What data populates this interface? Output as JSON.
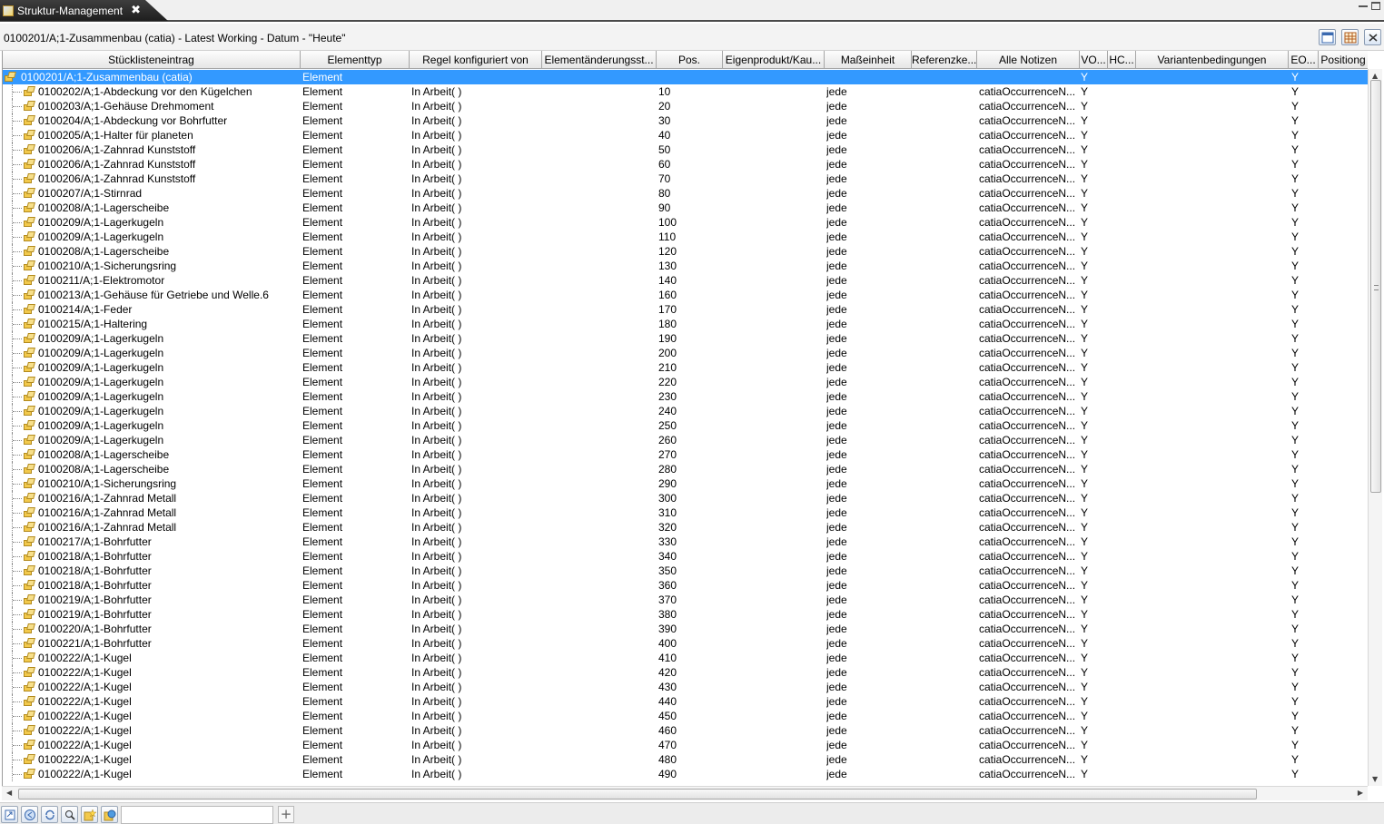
{
  "tab": {
    "title": "Struktur-Management",
    "close": "✖"
  },
  "info": {
    "path": "0100201/A;1-Zusammenbau (catia) - Latest Working - Datum - \"Heute\""
  },
  "columns": [
    {
      "label": "Stücklisteneintrag"
    },
    {
      "label": "Elementtyp"
    },
    {
      "label": "Regel konfiguriert von"
    },
    {
      "label": "Elementänderungsst..."
    },
    {
      "label": "Pos."
    },
    {
      "label": "Eigenprodukt/Kau..."
    },
    {
      "label": "Maßeinheit"
    },
    {
      "label": "Referenzke..."
    },
    {
      "label": "Alle Notizen"
    },
    {
      "label": "VO..."
    },
    {
      "label": "HC..."
    },
    {
      "label": "Variantenbedingungen"
    },
    {
      "label": "EO..."
    },
    {
      "label": "Positiong"
    }
  ],
  "root": {
    "entry": "0100201/A;1-Zusammenbau (catia)",
    "type": "Element",
    "vo": "Y",
    "eo": "Y"
  },
  "rows": [
    {
      "entry": "0100202/A;1-Abdeckung vor den Kügelchen",
      "type": "Element",
      "rule": "In Arbeit( )",
      "pos": "10",
      "unit": "jede",
      "notes": "catiaOccurrenceN...",
      "vo": "Y",
      "eo": "Y"
    },
    {
      "entry": "0100203/A;1-Gehäuse Drehmoment",
      "type": "Element",
      "rule": "In Arbeit( )",
      "pos": "20",
      "unit": "jede",
      "notes": "catiaOccurrenceN...",
      "vo": "Y",
      "eo": "Y"
    },
    {
      "entry": "0100204/A;1-Abdeckung vor Bohrfutter",
      "type": "Element",
      "rule": "In Arbeit( )",
      "pos": "30",
      "unit": "jede",
      "notes": "catiaOccurrenceN...",
      "vo": "Y",
      "eo": "Y"
    },
    {
      "entry": "0100205/A;1-Halter für planeten",
      "type": "Element",
      "rule": "In Arbeit( )",
      "pos": "40",
      "unit": "jede",
      "notes": "catiaOccurrenceN...",
      "vo": "Y",
      "eo": "Y"
    },
    {
      "entry": "0100206/A;1-Zahnrad Kunststoff",
      "type": "Element",
      "rule": "In Arbeit( )",
      "pos": "50",
      "unit": "jede",
      "notes": "catiaOccurrenceN...",
      "vo": "Y",
      "eo": "Y"
    },
    {
      "entry": "0100206/A;1-Zahnrad Kunststoff",
      "type": "Element",
      "rule": "In Arbeit( )",
      "pos": "60",
      "unit": "jede",
      "notes": "catiaOccurrenceN...",
      "vo": "Y",
      "eo": "Y"
    },
    {
      "entry": "0100206/A;1-Zahnrad Kunststoff",
      "type": "Element",
      "rule": "In Arbeit( )",
      "pos": "70",
      "unit": "jede",
      "notes": "catiaOccurrenceN...",
      "vo": "Y",
      "eo": "Y"
    },
    {
      "entry": "0100207/A;1-Stirnrad",
      "type": "Element",
      "rule": "In Arbeit( )",
      "pos": "80",
      "unit": "jede",
      "notes": "catiaOccurrenceN...",
      "vo": "Y",
      "eo": "Y"
    },
    {
      "entry": "0100208/A;1-Lagerscheibe",
      "type": "Element",
      "rule": "In Arbeit( )",
      "pos": "90",
      "unit": "jede",
      "notes": "catiaOccurrenceN...",
      "vo": "Y",
      "eo": "Y"
    },
    {
      "entry": "0100209/A;1-Lagerkugeln",
      "type": "Element",
      "rule": "In Arbeit( )",
      "pos": "100",
      "unit": "jede",
      "notes": "catiaOccurrenceN...",
      "vo": "Y",
      "eo": "Y"
    },
    {
      "entry": "0100209/A;1-Lagerkugeln",
      "type": "Element",
      "rule": "In Arbeit( )",
      "pos": "110",
      "unit": "jede",
      "notes": "catiaOccurrenceN...",
      "vo": "Y",
      "eo": "Y"
    },
    {
      "entry": "0100208/A;1-Lagerscheibe",
      "type": "Element",
      "rule": "In Arbeit( )",
      "pos": "120",
      "unit": "jede",
      "notes": "catiaOccurrenceN...",
      "vo": "Y",
      "eo": "Y"
    },
    {
      "entry": "0100210/A;1-Sicherungsring",
      "type": "Element",
      "rule": "In Arbeit( )",
      "pos": "130",
      "unit": "jede",
      "notes": "catiaOccurrenceN...",
      "vo": "Y",
      "eo": "Y"
    },
    {
      "entry": "0100211/A;1-Elektromotor",
      "type": "Element",
      "rule": "In Arbeit( )",
      "pos": "140",
      "unit": "jede",
      "notes": "catiaOccurrenceN...",
      "vo": "Y",
      "eo": "Y"
    },
    {
      "entry": "0100213/A;1-Gehäuse für Getriebe und Welle.6",
      "type": "Element",
      "rule": "In Arbeit( )",
      "pos": "160",
      "unit": "jede",
      "notes": "catiaOccurrenceN...",
      "vo": "Y",
      "eo": "Y"
    },
    {
      "entry": "0100214/A;1-Feder",
      "type": "Element",
      "rule": "In Arbeit( )",
      "pos": "170",
      "unit": "jede",
      "notes": "catiaOccurrenceN...",
      "vo": "Y",
      "eo": "Y"
    },
    {
      "entry": "0100215/A;1-Haltering",
      "type": "Element",
      "rule": "In Arbeit( )",
      "pos": "180",
      "unit": "jede",
      "notes": "catiaOccurrenceN...",
      "vo": "Y",
      "eo": "Y"
    },
    {
      "entry": "0100209/A;1-Lagerkugeln",
      "type": "Element",
      "rule": "In Arbeit( )",
      "pos": "190",
      "unit": "jede",
      "notes": "catiaOccurrenceN...",
      "vo": "Y",
      "eo": "Y"
    },
    {
      "entry": "0100209/A;1-Lagerkugeln",
      "type": "Element",
      "rule": "In Arbeit( )",
      "pos": "200",
      "unit": "jede",
      "notes": "catiaOccurrenceN...",
      "vo": "Y",
      "eo": "Y"
    },
    {
      "entry": "0100209/A;1-Lagerkugeln",
      "type": "Element",
      "rule": "In Arbeit( )",
      "pos": "210",
      "unit": "jede",
      "notes": "catiaOccurrenceN...",
      "vo": "Y",
      "eo": "Y"
    },
    {
      "entry": "0100209/A;1-Lagerkugeln",
      "type": "Element",
      "rule": "In Arbeit( )",
      "pos": "220",
      "unit": "jede",
      "notes": "catiaOccurrenceN...",
      "vo": "Y",
      "eo": "Y"
    },
    {
      "entry": "0100209/A;1-Lagerkugeln",
      "type": "Element",
      "rule": "In Arbeit( )",
      "pos": "230",
      "unit": "jede",
      "notes": "catiaOccurrenceN...",
      "vo": "Y",
      "eo": "Y"
    },
    {
      "entry": "0100209/A;1-Lagerkugeln",
      "type": "Element",
      "rule": "In Arbeit( )",
      "pos": "240",
      "unit": "jede",
      "notes": "catiaOccurrenceN...",
      "vo": "Y",
      "eo": "Y"
    },
    {
      "entry": "0100209/A;1-Lagerkugeln",
      "type": "Element",
      "rule": "In Arbeit( )",
      "pos": "250",
      "unit": "jede",
      "notes": "catiaOccurrenceN...",
      "vo": "Y",
      "eo": "Y"
    },
    {
      "entry": "0100209/A;1-Lagerkugeln",
      "type": "Element",
      "rule": "In Arbeit( )",
      "pos": "260",
      "unit": "jede",
      "notes": "catiaOccurrenceN...",
      "vo": "Y",
      "eo": "Y"
    },
    {
      "entry": "0100208/A;1-Lagerscheibe",
      "type": "Element",
      "rule": "In Arbeit( )",
      "pos": "270",
      "unit": "jede",
      "notes": "catiaOccurrenceN...",
      "vo": "Y",
      "eo": "Y"
    },
    {
      "entry": "0100208/A;1-Lagerscheibe",
      "type": "Element",
      "rule": "In Arbeit( )",
      "pos": "280",
      "unit": "jede",
      "notes": "catiaOccurrenceN...",
      "vo": "Y",
      "eo": "Y"
    },
    {
      "entry": "0100210/A;1-Sicherungsring",
      "type": "Element",
      "rule": "In Arbeit( )",
      "pos": "290",
      "unit": "jede",
      "notes": "catiaOccurrenceN...",
      "vo": "Y",
      "eo": "Y"
    },
    {
      "entry": "0100216/A;1-Zahnrad Metall",
      "type": "Element",
      "rule": "In Arbeit( )",
      "pos": "300",
      "unit": "jede",
      "notes": "catiaOccurrenceN...",
      "vo": "Y",
      "eo": "Y"
    },
    {
      "entry": "0100216/A;1-Zahnrad Metall",
      "type": "Element",
      "rule": "In Arbeit( )",
      "pos": "310",
      "unit": "jede",
      "notes": "catiaOccurrenceN...",
      "vo": "Y",
      "eo": "Y"
    },
    {
      "entry": "0100216/A;1-Zahnrad Metall",
      "type": "Element",
      "rule": "In Arbeit( )",
      "pos": "320",
      "unit": "jede",
      "notes": "catiaOccurrenceN...",
      "vo": "Y",
      "eo": "Y"
    },
    {
      "entry": "0100217/A;1-Bohrfutter",
      "type": "Element",
      "rule": "In Arbeit( )",
      "pos": "330",
      "unit": "jede",
      "notes": "catiaOccurrenceN...",
      "vo": "Y",
      "eo": "Y"
    },
    {
      "entry": "0100218/A;1-Bohrfutter",
      "type": "Element",
      "rule": "In Arbeit( )",
      "pos": "340",
      "unit": "jede",
      "notes": "catiaOccurrenceN...",
      "vo": "Y",
      "eo": "Y"
    },
    {
      "entry": "0100218/A;1-Bohrfutter",
      "type": "Element",
      "rule": "In Arbeit( )",
      "pos": "350",
      "unit": "jede",
      "notes": "catiaOccurrenceN...",
      "vo": "Y",
      "eo": "Y"
    },
    {
      "entry": "0100218/A;1-Bohrfutter",
      "type": "Element",
      "rule": "In Arbeit( )",
      "pos": "360",
      "unit": "jede",
      "notes": "catiaOccurrenceN...",
      "vo": "Y",
      "eo": "Y"
    },
    {
      "entry": "0100219/A;1-Bohrfutter",
      "type": "Element",
      "rule": "In Arbeit( )",
      "pos": "370",
      "unit": "jede",
      "notes": "catiaOccurrenceN...",
      "vo": "Y",
      "eo": "Y"
    },
    {
      "entry": "0100219/A;1-Bohrfutter",
      "type": "Element",
      "rule": "In Arbeit( )",
      "pos": "380",
      "unit": "jede",
      "notes": "catiaOccurrenceN...",
      "vo": "Y",
      "eo": "Y"
    },
    {
      "entry": "0100220/A;1-Bohrfutter",
      "type": "Element",
      "rule": "In Arbeit( )",
      "pos": "390",
      "unit": "jede",
      "notes": "catiaOccurrenceN...",
      "vo": "Y",
      "eo": "Y"
    },
    {
      "entry": "0100221/A;1-Bohrfutter",
      "type": "Element",
      "rule": "In Arbeit( )",
      "pos": "400",
      "unit": "jede",
      "notes": "catiaOccurrenceN...",
      "vo": "Y",
      "eo": "Y"
    },
    {
      "entry": "0100222/A;1-Kugel",
      "type": "Element",
      "rule": "In Arbeit( )",
      "pos": "410",
      "unit": "jede",
      "notes": "catiaOccurrenceN...",
      "vo": "Y",
      "eo": "Y"
    },
    {
      "entry": "0100222/A;1-Kugel",
      "type": "Element",
      "rule": "In Arbeit( )",
      "pos": "420",
      "unit": "jede",
      "notes": "catiaOccurrenceN...",
      "vo": "Y",
      "eo": "Y"
    },
    {
      "entry": "0100222/A;1-Kugel",
      "type": "Element",
      "rule": "In Arbeit( )",
      "pos": "430",
      "unit": "jede",
      "notes": "catiaOccurrenceN...",
      "vo": "Y",
      "eo": "Y"
    },
    {
      "entry": "0100222/A;1-Kugel",
      "type": "Element",
      "rule": "In Arbeit( )",
      "pos": "440",
      "unit": "jede",
      "notes": "catiaOccurrenceN...",
      "vo": "Y",
      "eo": "Y"
    },
    {
      "entry": "0100222/A;1-Kugel",
      "type": "Element",
      "rule": "In Arbeit( )",
      "pos": "450",
      "unit": "jede",
      "notes": "catiaOccurrenceN...",
      "vo": "Y",
      "eo": "Y"
    },
    {
      "entry": "0100222/A;1-Kugel",
      "type": "Element",
      "rule": "In Arbeit( )",
      "pos": "460",
      "unit": "jede",
      "notes": "catiaOccurrenceN...",
      "vo": "Y",
      "eo": "Y"
    },
    {
      "entry": "0100222/A;1-Kugel",
      "type": "Element",
      "rule": "In Arbeit( )",
      "pos": "470",
      "unit": "jede",
      "notes": "catiaOccurrenceN...",
      "vo": "Y",
      "eo": "Y"
    },
    {
      "entry": "0100222/A;1-Kugel",
      "type": "Element",
      "rule": "In Arbeit( )",
      "pos": "480",
      "unit": "jede",
      "notes": "catiaOccurrenceN...",
      "vo": "Y",
      "eo": "Y"
    },
    {
      "entry": "0100222/A;1-Kugel",
      "type": "Element",
      "rule": "In Arbeit( )",
      "pos": "490",
      "unit": "jede",
      "notes": "catiaOccurrenceN...",
      "vo": "Y",
      "eo": "Y"
    }
  ],
  "icons": {
    "tab": "structure-icon",
    "toolbar": [
      "window-icon",
      "table-icon",
      "collapse-icon"
    ],
    "bottom": [
      "refresh-icon",
      "back-icon",
      "sync-icon",
      "find-icon",
      "star-icon",
      "globe-icon"
    ],
    "add": "+"
  },
  "colors": {
    "selection": "#3399ff",
    "tab_bg": "#2e2e2e"
  }
}
